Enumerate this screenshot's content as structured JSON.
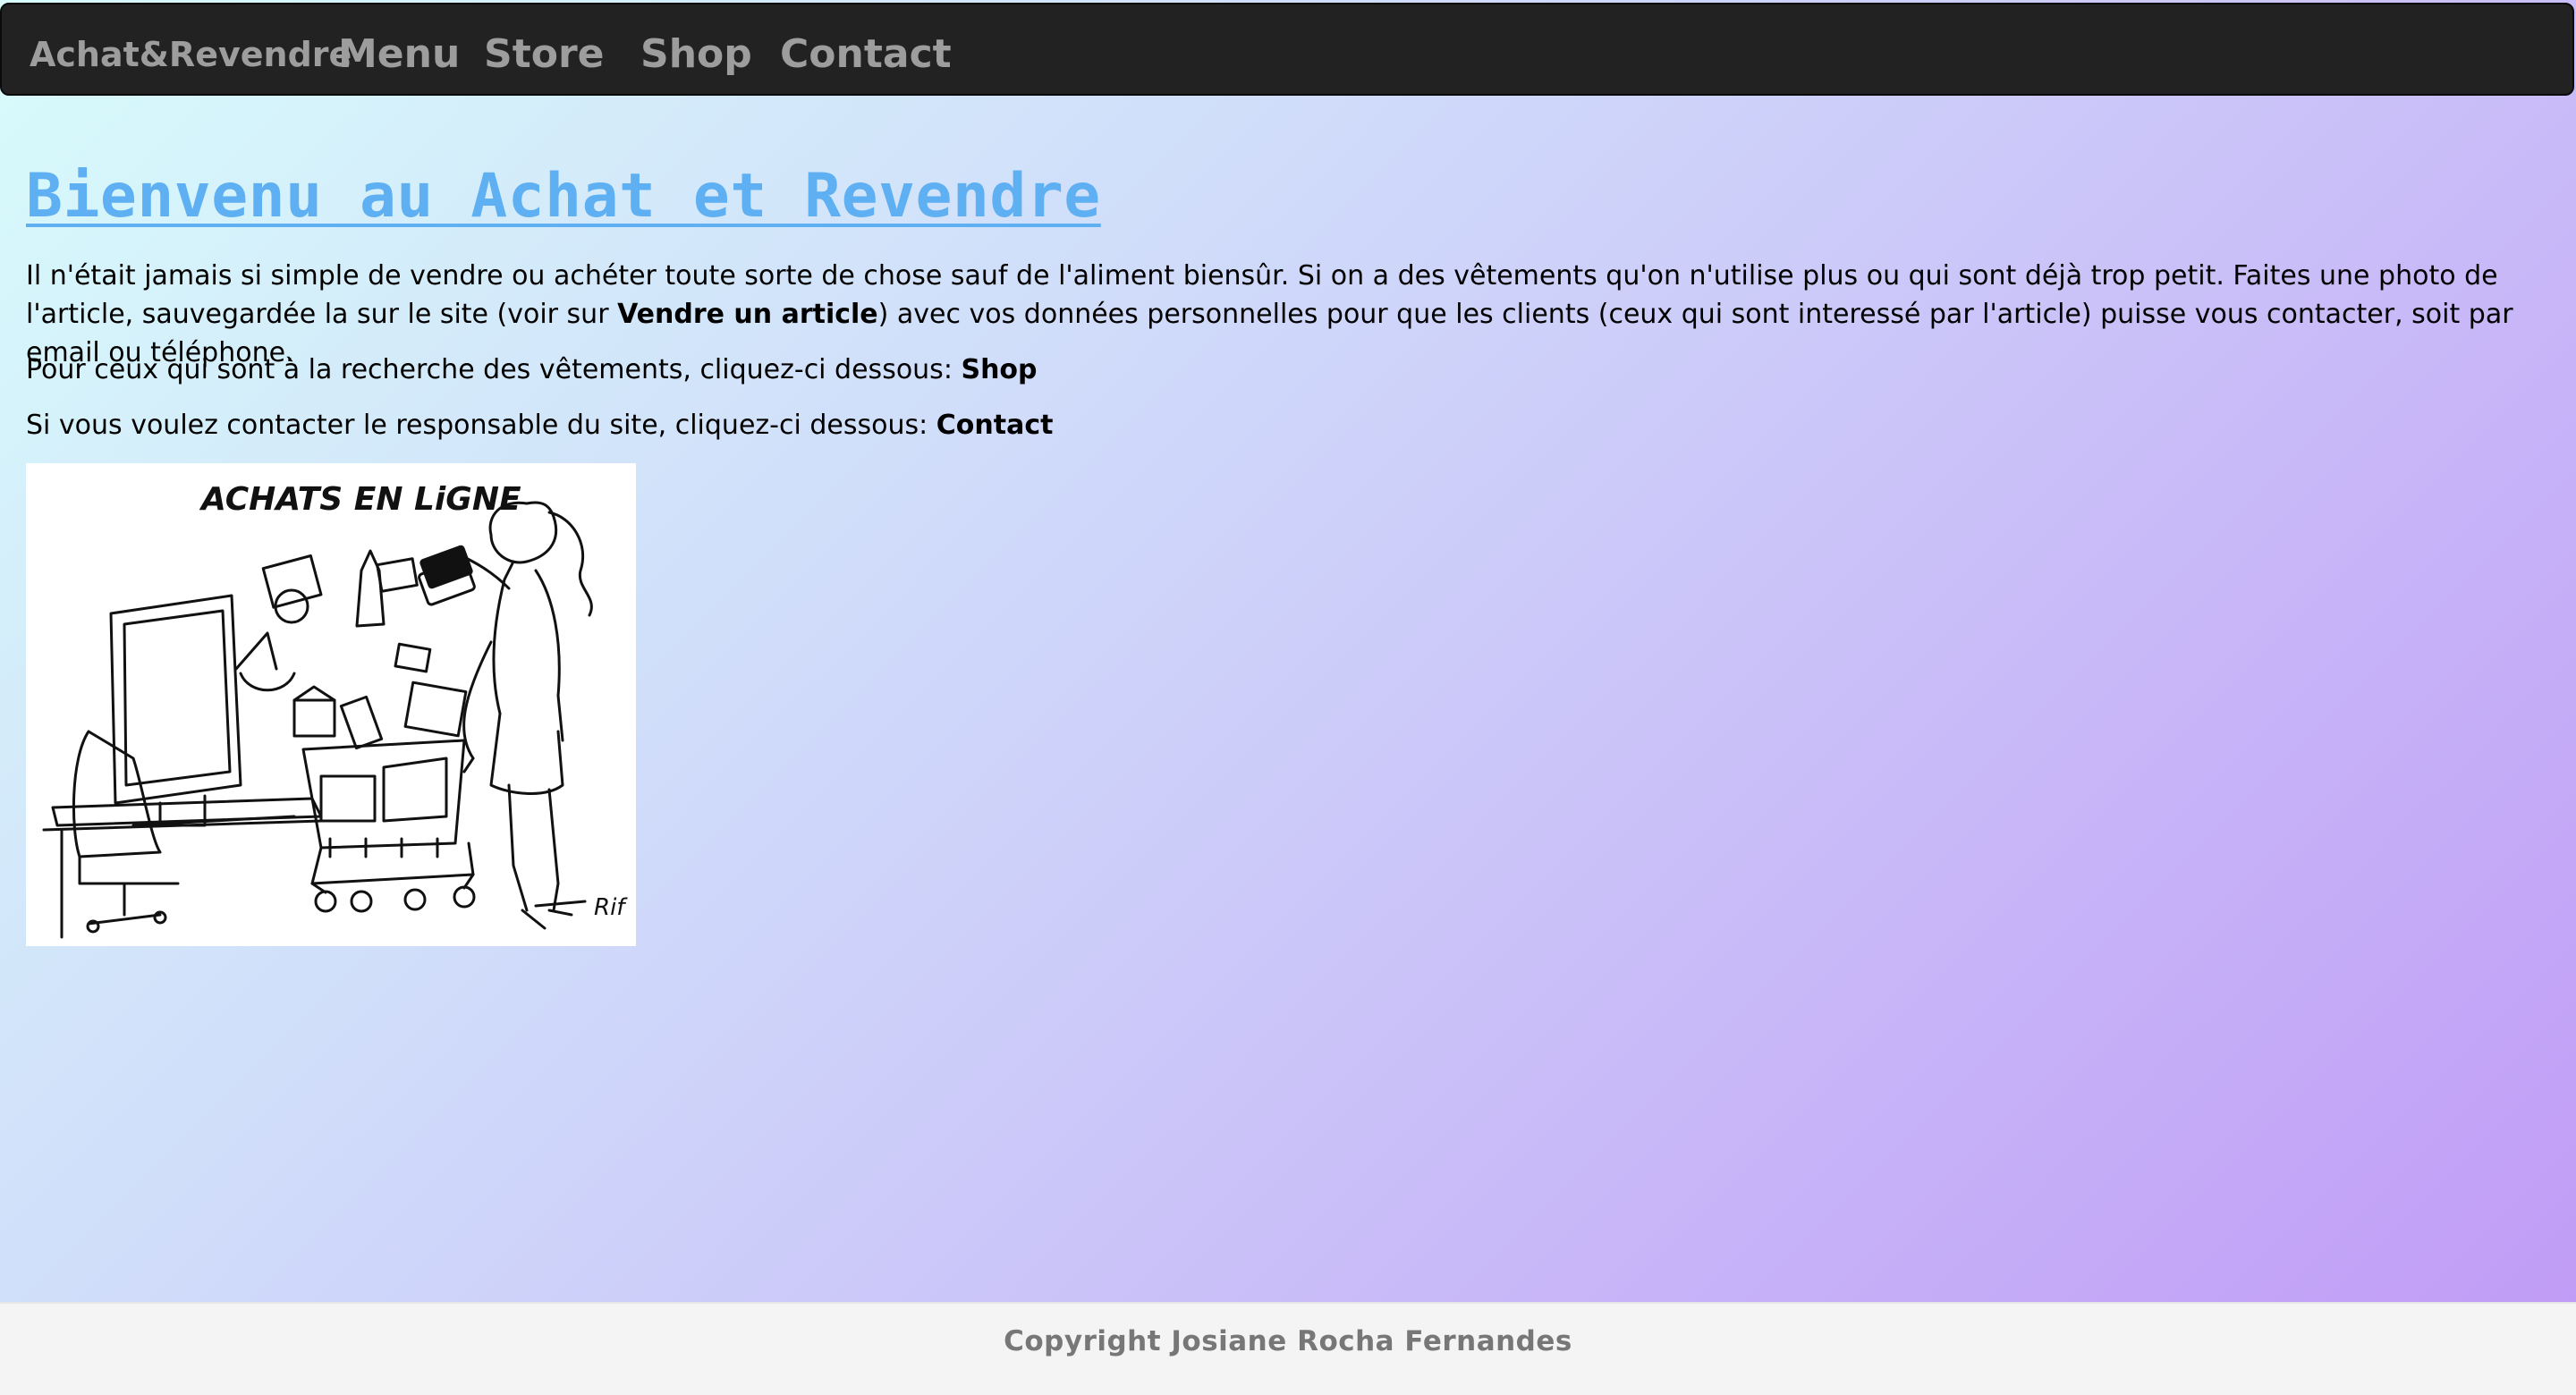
{
  "navbar": {
    "brand": "Achat&Revendre",
    "items": [
      {
        "label": "Menu"
      },
      {
        "label": "Store"
      },
      {
        "label": "Shop"
      },
      {
        "label": "Contact"
      }
    ]
  },
  "main": {
    "heading": "Bienvenu au Achat et Revendre",
    "intro": {
      "text_before": "Il n'était jamais si simple de vendre ou achéter toute sorte de chose sauf de l'aliment biensûr. Si on a des vêtements qu'on n'utilise plus ou qui sont déjà trop petit. Faites une photo de l'article, sauvegardée la sur le site (voir sur ",
      "link": "Vendre un article",
      "text_after": ") avec vos données personnelles pour que les clients (ceux qui sont interessé par l'article) puisse vous contacter, soit par email ou téléphone."
    },
    "shop_line": {
      "text": "Pour ceux qui sont à la recherche des vêtements, cliquez-ci dessous: ",
      "link": "Shop"
    },
    "contact_line": {
      "text": "Si vous voulez contacter le responsable du site, cliquez-ci dessous: ",
      "link": "Contact"
    },
    "illustration": {
      "caption": "ACHATS EN LiGNE",
      "signature": "Rif"
    }
  },
  "footer": {
    "copyright": "Copyright Josiane Rocha Fernandes"
  },
  "colors": {
    "navbar_bg": "#222222",
    "nav_text": "#9d9d9d",
    "heading": "#5fb0f2",
    "footer_bg": "#f4f4f4",
    "footer_text": "#777777",
    "gradient_start": "#d8fcfb",
    "gradient_end": "#c09af6"
  }
}
